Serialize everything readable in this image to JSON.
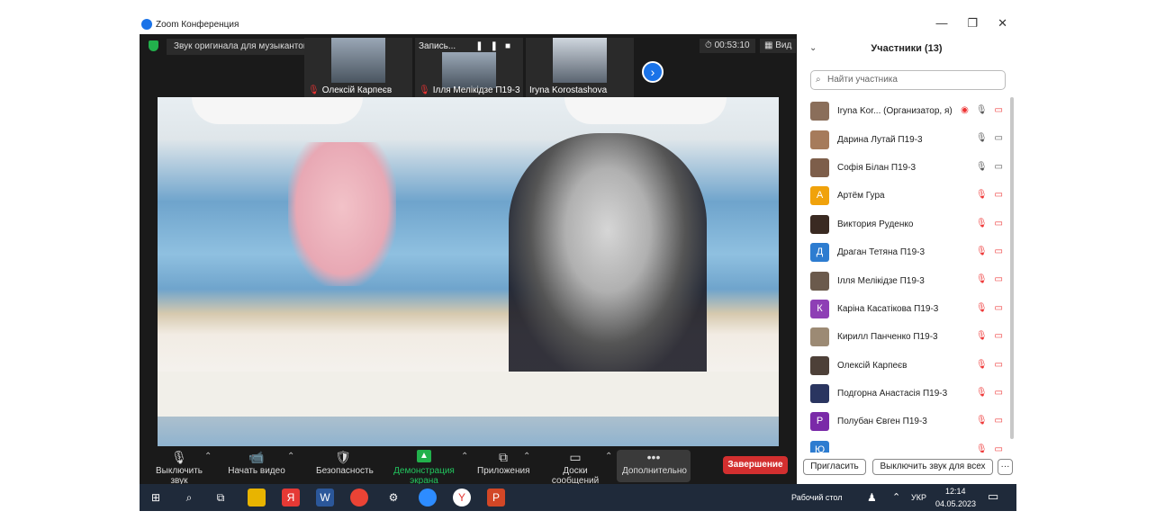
{
  "window": {
    "title": "Zoom Конференция",
    "min": "—",
    "max": "❐",
    "close": "✕"
  },
  "meeting": {
    "audio_notice": "Звук оригинала для музыкантов выключен",
    "recording": {
      "label": "Запись...",
      "pause": "❚❚",
      "stop": "■"
    },
    "thumbnails": [
      {
        "name": "Олексій Карпеєв",
        "muted": true
      },
      {
        "name": "Ілля Мелікідзе П19-3",
        "muted": true
      },
      {
        "name": "Iryna Korostashova",
        "muted": false
      }
    ],
    "next_icon": "›",
    "timer": "00:53:10",
    "view_label": "Вид"
  },
  "toolbar": {
    "mute": {
      "label": "Выключить звук",
      "icon": "🎙"
    },
    "video": {
      "label": "Начать видео",
      "icon": "📹"
    },
    "security": {
      "label": "Безопасность",
      "icon": "🛡"
    },
    "share": {
      "label": "Демонстрация экрана",
      "icon": "▲"
    },
    "apps": {
      "label": "Приложения",
      "icon": "⧉"
    },
    "boards": {
      "label": "Доски сообщений",
      "icon": "▭"
    },
    "more": {
      "label": "Дополнительно",
      "icon": "•••"
    },
    "end": "Завершение"
  },
  "participants": {
    "title": "Участники (13)",
    "search_placeholder": "Найти участника",
    "items": [
      {
        "name": "Iryna Kor... (Организатор, я)",
        "avatar": "",
        "color": "#8a6e5a",
        "mic": "on",
        "cam": "off",
        "rec": true
      },
      {
        "name": "Дарина Лутай П19-3",
        "avatar": "",
        "color": "#a67b5b",
        "mic": "on",
        "cam": "on"
      },
      {
        "name": "Софія Білан П19-3",
        "avatar": "",
        "color": "#7d5e4a",
        "mic": "on",
        "cam": "on"
      },
      {
        "name": "Артём Гура",
        "avatar": "А",
        "color": "#f0a20b",
        "mic": "off",
        "cam": "off"
      },
      {
        "name": "Виктория Руденко",
        "avatar": "",
        "color": "#3a2a22",
        "mic": "off",
        "cam": "off"
      },
      {
        "name": "Драган Тетяна П19-3",
        "avatar": "Д",
        "color": "#2d7cd0",
        "mic": "off",
        "cam": "off"
      },
      {
        "name": "Ілля Мелікідзе П19-3",
        "avatar": "",
        "color": "#6b5a4c",
        "mic": "off",
        "cam": "off"
      },
      {
        "name": "Каріна Касатікова П19-3",
        "avatar": "К",
        "color": "#8e3fb5",
        "mic": "off",
        "cam": "off"
      },
      {
        "name": "Кирилл Панченко П19-3",
        "avatar": "",
        "color": "#9c8a74",
        "mic": "off",
        "cam": "off"
      },
      {
        "name": "Олексій Карпеєв",
        "avatar": "",
        "color": "#4d4038",
        "mic": "off",
        "cam": "off"
      },
      {
        "name": "Подгорна Анастасія П19-3",
        "avatar": "",
        "color": "#2a3560",
        "mic": "off",
        "cam": "off"
      },
      {
        "name": "Полубан Євген П19-3",
        "avatar": "Р",
        "color": "#7a2aa8",
        "mic": "off",
        "cam": "off"
      },
      {
        "name": "",
        "avatar": "Ю",
        "color": "#2d7cd0",
        "mic": "off",
        "cam": "off"
      }
    ],
    "invite": "Пригласить",
    "unmute_all": "Выключить звук для всех",
    "more": "···"
  },
  "taskbar": {
    "desktop": "Рабочий стол",
    "lang": "УКР",
    "time": "12:14",
    "date": "04.05.2023"
  }
}
